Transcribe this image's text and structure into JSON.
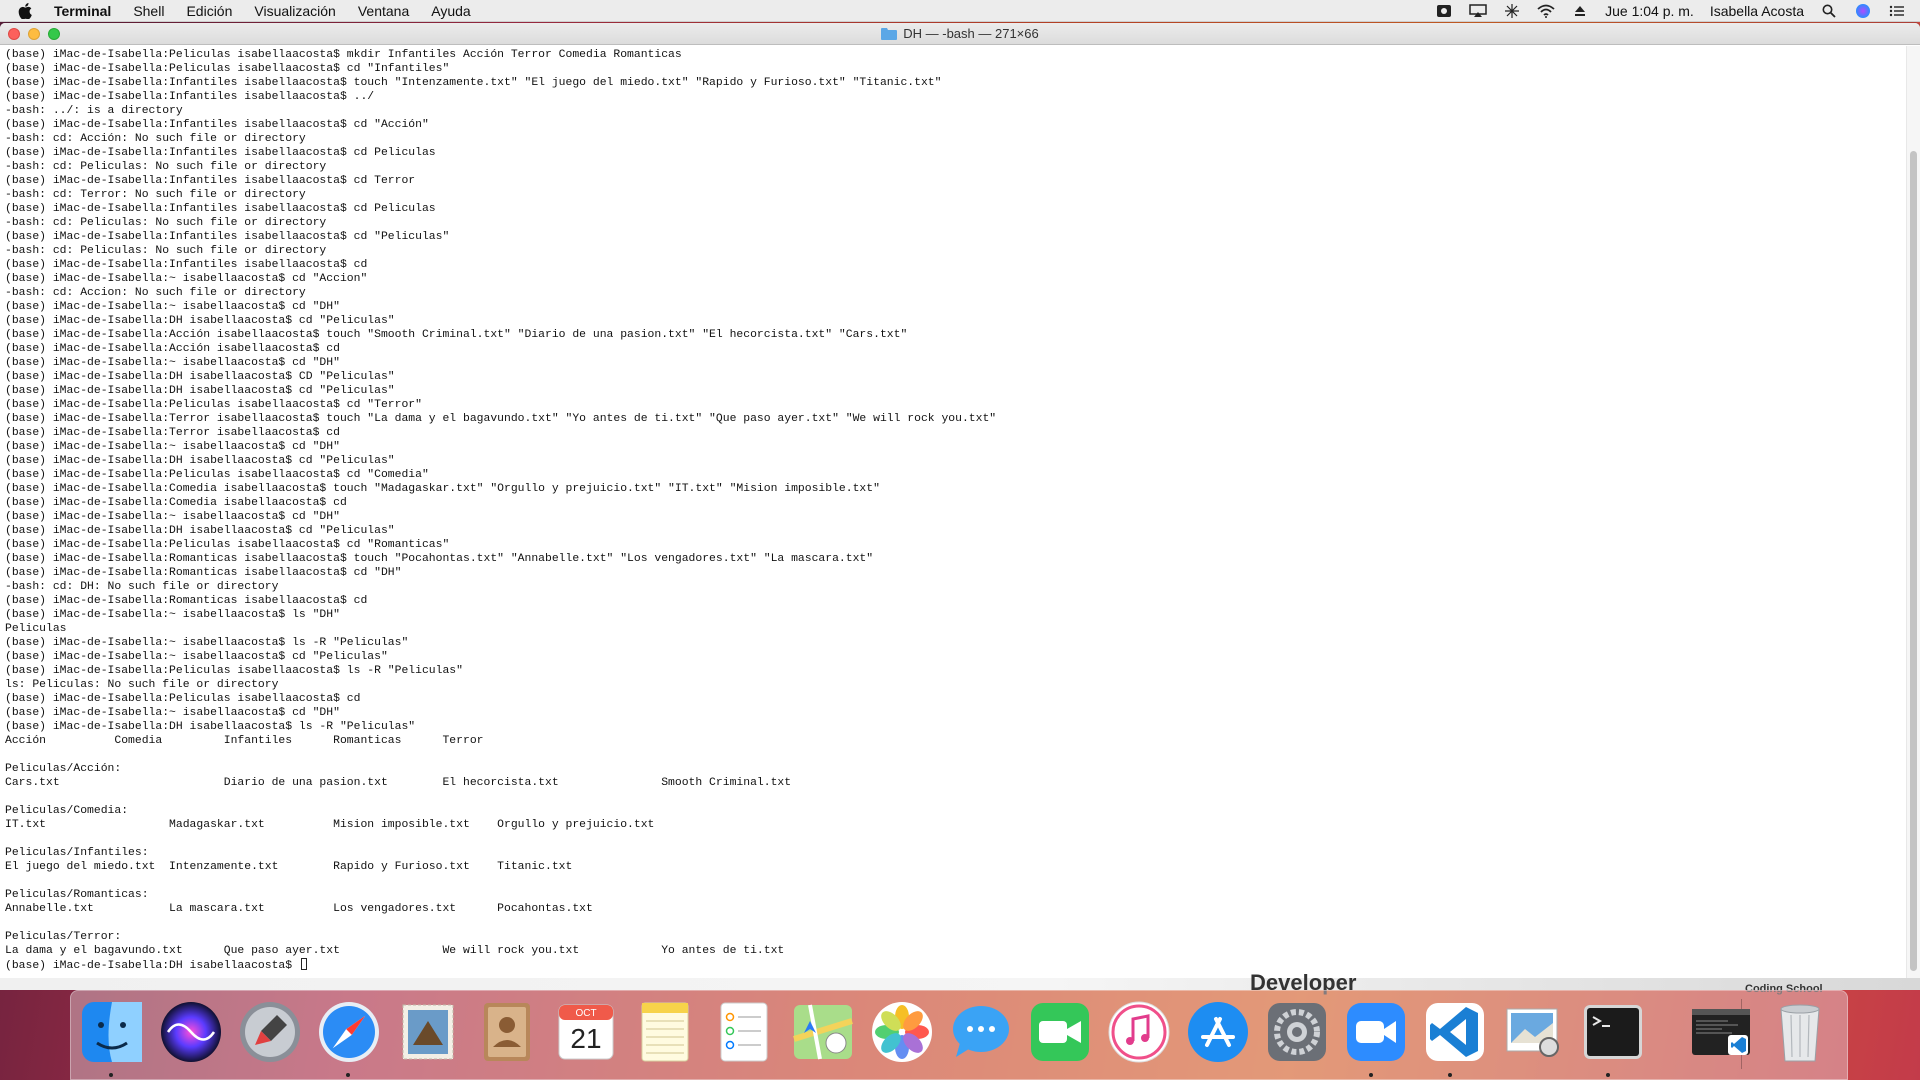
{
  "menubar": {
    "app_name": "Terminal",
    "items": [
      "Shell",
      "Edición",
      "Visualización",
      "Ventana",
      "Ayuda"
    ],
    "clock": "Jue 1:04 p. m.",
    "user": "Isabella Acosta"
  },
  "window": {
    "title": "DH — -bash — 271×66"
  },
  "terminal": {
    "lines": [
      "(base) iMac-de-Isabella:Peliculas isabellaacosta$ mkdir Infantiles Acción Terror Comedia Romanticas",
      "(base) iMac-de-Isabella:Peliculas isabellaacosta$ cd \"Infantiles\"",
      "(base) iMac-de-Isabella:Infantiles isabellaacosta$ touch \"Intenzamente.txt\" \"El juego del miedo.txt\" \"Rapido y Furioso.txt\" \"Titanic.txt\"",
      "(base) iMac-de-Isabella:Infantiles isabellaacosta$ ../",
      "-bash: ../: is a directory",
      "(base) iMac-de-Isabella:Infantiles isabellaacosta$ cd \"Acción\"",
      "-bash: cd: Acción: No such file or directory",
      "(base) iMac-de-Isabella:Infantiles isabellaacosta$ cd Peliculas",
      "-bash: cd: Peliculas: No such file or directory",
      "(base) iMac-de-Isabella:Infantiles isabellaacosta$ cd Terror",
      "-bash: cd: Terror: No such file or directory",
      "(base) iMac-de-Isabella:Infantiles isabellaacosta$ cd Peliculas",
      "-bash: cd: Peliculas: No such file or directory",
      "(base) iMac-de-Isabella:Infantiles isabellaacosta$ cd \"Peliculas\"",
      "-bash: cd: Peliculas: No such file or directory",
      "(base) iMac-de-Isabella:Infantiles isabellaacosta$ cd",
      "(base) iMac-de-Isabella:~ isabellaacosta$ cd \"Accion\"",
      "-bash: cd: Accion: No such file or directory",
      "(base) iMac-de-Isabella:~ isabellaacosta$ cd \"DH\"",
      "(base) iMac-de-Isabella:DH isabellaacosta$ cd \"Peliculas\"",
      "(base) iMac-de-Isabella:Acción isabellaacosta$ touch \"Smooth Criminal.txt\" \"Diario de una pasion.txt\" \"El hecorcista.txt\" \"Cars.txt\"",
      "(base) iMac-de-Isabella:Acción isabellaacosta$ cd",
      "(base) iMac-de-Isabella:~ isabellaacosta$ cd \"DH\"",
      "(base) iMac-de-Isabella:DH isabellaacosta$ CD \"Peliculas\"",
      "(base) iMac-de-Isabella:DH isabellaacosta$ cd \"Peliculas\"",
      "(base) iMac-de-Isabella:Peliculas isabellaacosta$ cd \"Terror\"",
      "(base) iMac-de-Isabella:Terror isabellaacosta$ touch \"La dama y el bagavundo.txt\" \"Yo antes de ti.txt\" \"Que paso ayer.txt\" \"We will rock you.txt\"",
      "(base) iMac-de-Isabella:Terror isabellaacosta$ cd",
      "(base) iMac-de-Isabella:~ isabellaacosta$ cd \"DH\"",
      "(base) iMac-de-Isabella:DH isabellaacosta$ cd \"Peliculas\"",
      "(base) iMac-de-Isabella:Peliculas isabellaacosta$ cd \"Comedia\"",
      "(base) iMac-de-Isabella:Comedia isabellaacosta$ touch \"Madagaskar.txt\" \"Orgullo y prejuicio.txt\" \"IT.txt\" \"Mision imposible.txt\"",
      "(base) iMac-de-Isabella:Comedia isabellaacosta$ cd",
      "(base) iMac-de-Isabella:~ isabellaacosta$ cd \"DH\"",
      "(base) iMac-de-Isabella:DH isabellaacosta$ cd \"Peliculas\"",
      "(base) iMac-de-Isabella:Peliculas isabellaacosta$ cd \"Romanticas\"",
      "(base) iMac-de-Isabella:Romanticas isabellaacosta$ touch \"Pocahontas.txt\" \"Annabelle.txt\" \"Los vengadores.txt\" \"La mascara.txt\"",
      "(base) iMac-de-Isabella:Romanticas isabellaacosta$ cd \"DH\"",
      "-bash: cd: DH: No such file or directory",
      "(base) iMac-de-Isabella:Romanticas isabellaacosta$ cd",
      "(base) iMac-de-Isabella:~ isabellaacosta$ ls \"DH\"",
      "Peliculas",
      "(base) iMac-de-Isabella:~ isabellaacosta$ ls -R \"Peliculas\"",
      "(base) iMac-de-Isabella:~ isabellaacosta$ cd \"Peliculas\"",
      "(base) iMac-de-Isabella:Peliculas isabellaacosta$ ls -R \"Peliculas\"",
      "ls: Peliculas: No such file or directory",
      "(base) iMac-de-Isabella:Peliculas isabellaacosta$ cd",
      "(base) iMac-de-Isabella:~ isabellaacosta$ cd \"DH\"",
      "(base) iMac-de-Isabella:DH isabellaacosta$ ls -R \"Peliculas\"",
      "Acción          Comedia         Infantiles      Romanticas      Terror",
      "",
      "Peliculas/Acción:",
      "Cars.txt                        Diario de una pasion.txt        El hecorcista.txt               Smooth Criminal.txt",
      "",
      "Peliculas/Comedia:",
      "IT.txt                  Madagaskar.txt          Mision imposible.txt    Orgullo y prejuicio.txt",
      "",
      "Peliculas/Infantiles:",
      "El juego del miedo.txt  Intenzamente.txt        Rapido y Furioso.txt    Titanic.txt",
      "",
      "Peliculas/Romanticas:",
      "Annabelle.txt           La mascara.txt          Los vengadores.txt      Pocahontas.txt",
      "",
      "Peliculas/Terror:",
      "La dama y el bagavundo.txt      Que paso ayer.txt               We will rock you.txt            Yo antes de ti.txt"
    ],
    "prompt": "(base) iMac-de-Isabella:DH isabellaacosta$ "
  },
  "background": {
    "text_1": "Developer",
    "text_2": "Coding School"
  },
  "dock": {
    "calendar_month": "OCT",
    "calendar_day": "21",
    "items": [
      "finder-icon",
      "siri-icon",
      "launchpad-icon",
      "safari-icon",
      "mail-icon",
      "contacts-icon",
      "calendar-icon",
      "notes-icon",
      "reminders-icon",
      "maps-icon",
      "photos-icon",
      "messages-icon",
      "facetime-icon",
      "itunes-icon",
      "app-store-icon",
      "system-preferences-icon",
      "zoom-icon",
      "vscode-icon",
      "preview-icon",
      "terminal-icon",
      "terminal-window-icon",
      "trash-icon"
    ]
  }
}
